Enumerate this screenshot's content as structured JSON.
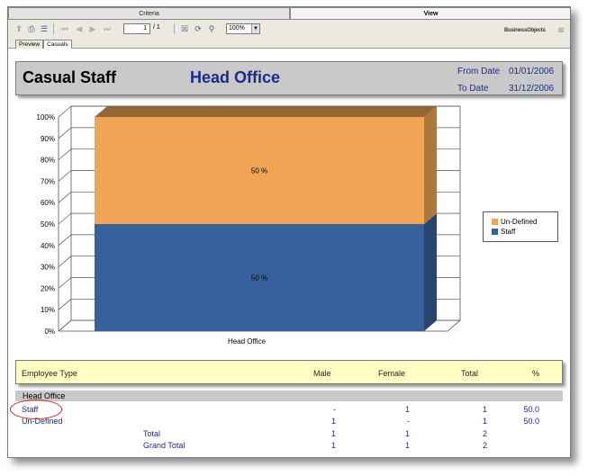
{
  "top_tabs": {
    "criteria": "Criteria",
    "view": "View"
  },
  "toolbar": {
    "page_current": "1",
    "page_total": "/ 1",
    "zoom": "100%",
    "brand": "BusinessObjects",
    "close": "☒"
  },
  "sub_tabs": {
    "preview": "Preview",
    "casuals": "Casuals"
  },
  "report": {
    "title": "Casual Staff",
    "location": "Head Office",
    "from_label": "From Date",
    "from_value": "01/01/2006",
    "to_label": "To Date",
    "to_value": "31/12/2006"
  },
  "chart_data": {
    "type": "bar",
    "stacked": true,
    "percent": true,
    "categories": [
      "Head Office"
    ],
    "series": [
      {
        "name": "Staff",
        "values": [
          50
        ],
        "label": "50 %",
        "color": "#38609a"
      },
      {
        "name": "Un-Defined",
        "values": [
          50
        ],
        "label": "50 %",
        "color": "#f0a555"
      }
    ],
    "yticks": [
      "0%",
      "10%",
      "20%",
      "30%",
      "40%",
      "50%",
      "60%",
      "70%",
      "80%",
      "90%",
      "100%"
    ],
    "ylim": [
      0,
      100
    ],
    "legend": "right",
    "grid": true
  },
  "table": {
    "headers": {
      "type": "Employee Type",
      "male": "Male",
      "female": "Female",
      "total": "Total",
      "pct": "%"
    },
    "group": "Head Office",
    "rows": [
      {
        "type": "Staff",
        "male": "-",
        "female": "1",
        "total": "1",
        "pct": "50.0"
      },
      {
        "type": "Un-Defined",
        "male": "1",
        "female": "-",
        "total": "1",
        "pct": "50.0"
      }
    ],
    "total": {
      "label": "Total",
      "male": "1",
      "female": "1",
      "total": "2"
    },
    "grand_total": {
      "label": "Grand Total",
      "male": "1",
      "female": "1",
      "total": "2"
    }
  }
}
